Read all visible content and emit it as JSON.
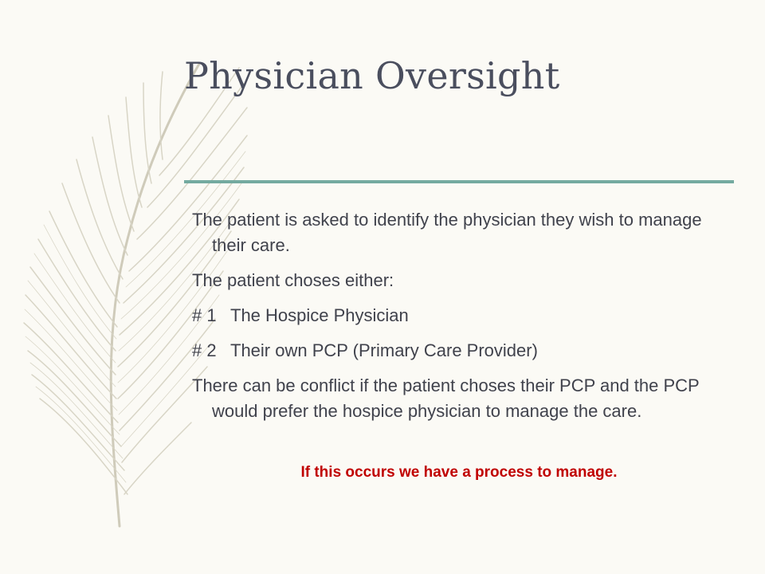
{
  "slide": {
    "title": "Physician Oversight",
    "accent_color": "#74aaa0",
    "paragraphs": [
      "The patient is asked to identify the physician they wish to manage their care.",
      "The patient choses either:"
    ],
    "options": [
      {
        "number": "# 1",
        "text": "The Hospice Physician"
      },
      {
        "number": "# 2",
        "text": "Their own PCP (Primary Care Provider)"
      }
    ],
    "conflict_paragraph": "There can be conflict if the patient choses their PCP and the PCP would prefer the hospice physician to manage the care.",
    "note": "If this occurs we have a process to manage.",
    "note_color": "#c00000",
    "decoration_icon": "feather-icon"
  }
}
